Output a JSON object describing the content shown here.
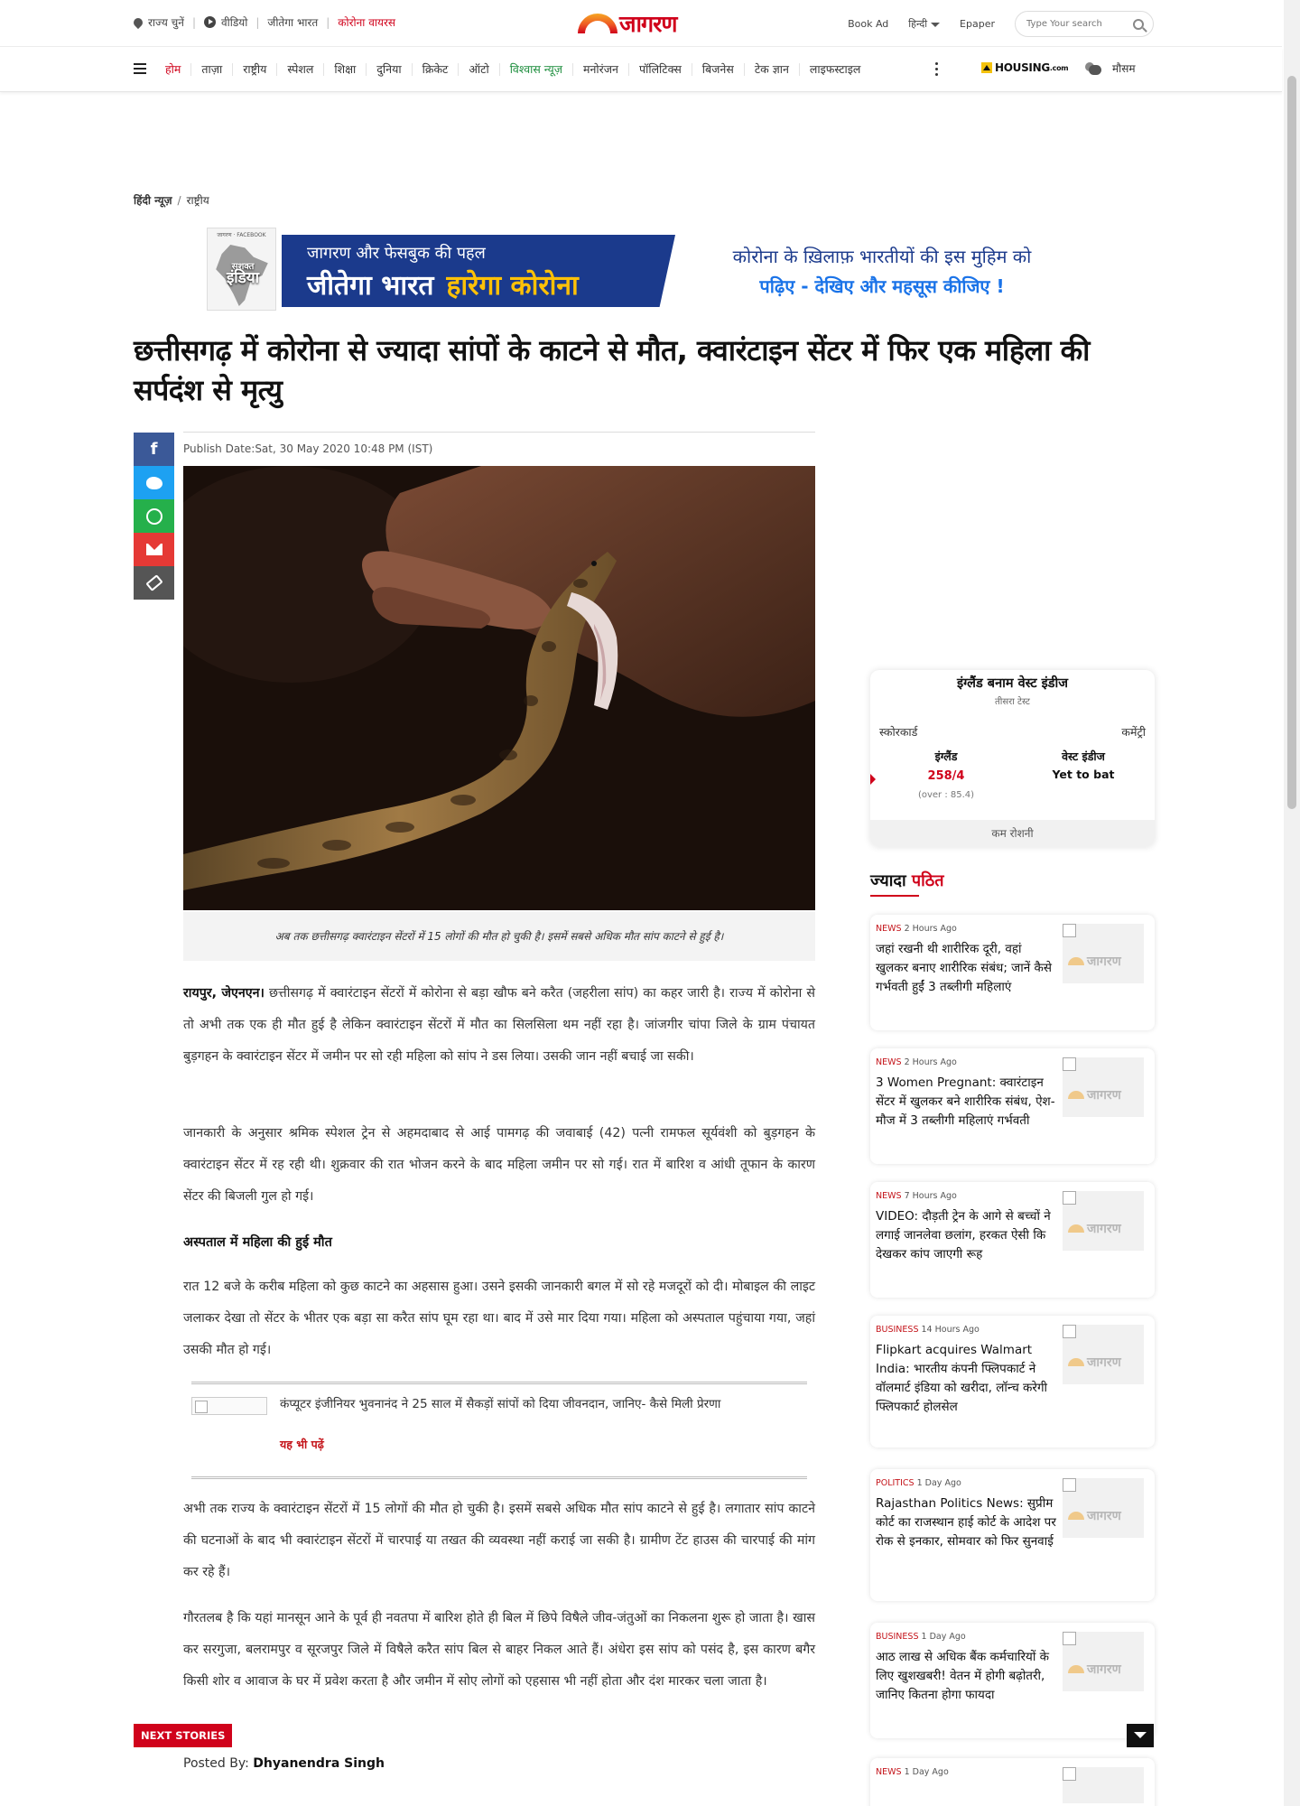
{
  "topbar": {
    "state_select": "राज्य चुनें",
    "video": "वीडियो",
    "jeetega_bharat": "जीतेगा भारत",
    "corona_virus": "कोरोना वायरस",
    "logo_text": "जागरण",
    "book_ad": "Book Ad",
    "language": "हिन्दी",
    "epaper": "Epaper",
    "search_placeholder": "Type Your search"
  },
  "nav": {
    "items": [
      "होम",
      "ताज़ा",
      "राष्ट्रीय",
      "स्पेशल",
      "शिक्षा",
      "दुनिया",
      "क्रिकेट",
      "ऑटो",
      "विश्वास न्यूज़",
      "मनोरंजन",
      "पॉलिटिक्स",
      "बिजनेस",
      "टेक ज्ञान",
      "लाइफस्टाइल"
    ],
    "housing": "HOUSING",
    "housing_suffix": ".com",
    "weather": "मौसम"
  },
  "breadcrumb": {
    "home": "हिंदी न्यूज़",
    "separator": "/",
    "section": "राष्ट्रीय"
  },
  "banner": {
    "badge_top": "जागरण · FACEBOOK",
    "badge_line1": "सशक्त",
    "badge_line2": "इंडिया",
    "line1": "जागरण और फेसबुक की पहल",
    "line2_a": "जीतेगा भारत",
    "line2_b": "हारेगा कोरोना",
    "right1": "कोरोना के ख़िलाफ़ भारतीयों की इस मुहिम को",
    "right2": "पढ़िए - देखिए और महसूस कीजिए !"
  },
  "article": {
    "headline": "छत्तीसगढ़ में कोरोना से ज्यादा सांपों के काटने से मौत, क्वारंटाइन सेंटर में फिर एक महिला की सर्पदंश से मृत्यु",
    "publish_date": "Publish Date:Sat, 30 May 2020 10:48 PM (IST)",
    "caption": "अब तक छत्तीसगढ़ क्वारंटाइन सेंटरों में 15 लोगों की मौत हो चुकी है। इसमें सबसे अधिक मौत सांप काटने से हुई है।",
    "dateline": "रायपुर, जेएनएन।",
    "p1": " छत्तीसगढ़ में क्वारंटाइन सेंटरों में कोरोना से बड़ा खौफ बने करैत (जहरीला सांप) का कहर जारी है। राज्य में कोरोना से तो अभी तक एक ही मौत हुई है लेकिन क्वारंटाइन सेंटरों में मौत का सिलसिला थम नहीं रहा है। जांजगीर चांपा जिले के ग्राम पंचायत बुड़गहन के क्वारंटाइन सेंटर में जमीन पर सो रही महिला को सांप ने डस लिया। उसकी जान नहीं बचाई जा सकी।",
    "p2": "जानकारी के अनुसार श्रमिक स्पेशल ट्रेन से अहमदाबाद से आई पामगढ़ की जवाबाई (42) पत्नी रामफल सूर्यवंशी को बुड़गहन के क्वारंटाइन सेंटर में रह रही थी। शुक्रवार की रात भोजन करने के बाद महिला जमीन पर सो गई। रात में बारिश व आंधी तूफान के कारण सेंटर की बिजली गुल हो गई।",
    "subheading": "अस्पताल में महिला की हुई मौत",
    "p3": "रात 12 बजे के करीब महिला को कुछ काटने का अहसास हुआ। उसने इसकी जानकारी बगल में सो रहे मजदूरों को दी। मोबाइल की लाइट जलाकर देखा तो सेंटर के भीतर एक बड़ा सा करैत सांप घूम रहा था। बाद में उसे मार दिया गया। महिला को अस्पताल पहुंचाया गया, जहां उसकी मौत हो गई।",
    "related_title": "कंप्यूटर इंजीनियर भुवनानंद ने 25 साल में सैकड़ों सांपों को दिया जीवनदान, जानिए- कैसे मिली प्रेरणा",
    "related_label": "यह भी पढ़ें",
    "p4": "अभी तक राज्य के क्वारंटाइन सेंटरों में 15 लोगों की मौत हो चुकी है। इसमें सबसे अधिक मौत सांप काटने से हुई है। लगातार सांप काटने की घटनाओं के बाद भी क्वारंटाइन सेंटरों में चारपाई या तखत की व्यवस्था नहीं कराई जा सकी है। ग्रामीण टेंट हाउस की चारपाई की मांग कर रहे हैं।",
    "p5": "गौरतलब है कि यहां मानसून आने के पूर्व ही नवतपा में बारिश होते ही बिल में छिपे विषैले जीव-जंतुओं का निकलना शुरू हो जाता है। खास कर सरगुजा, बलरामपुर व सूरजपुर जिले में विषैले करैत सांप बिल से बाहर निकल आते हैं। अंधेरा इस सांप को पसंद है, इस कारण बगैर किसी शोर व आवाज के घर में प्रवेश करता है और जमीन में सोए लोगों को एहसास भी नहीं होता और दंश मारकर चला जाता है।",
    "next_stories": "NEXT STORIES",
    "posted_by_label": "Posted By:",
    "posted_by": "Dhyanendra Singh"
  },
  "scorecard": {
    "title": "इंग्लैंड बनाम वेस्ट इंडीज",
    "subtitle": "तीसरा टेस्ट",
    "scorecard_label": "स्कोरकार्ड",
    "commentary_label": "कमेंट्री",
    "team1": "इंग्लैंड",
    "team1_score": "258/4",
    "team1_overs": "(over : 85.4)",
    "team2": "वेस्ट इंडीज",
    "team2_status": "Yet to bat",
    "footer": "कम रोशनी"
  },
  "most_read": {
    "heading_a": "ज्यादा",
    "heading_b": "पठित",
    "logo_text": "जागरण",
    "items": [
      {
        "category": "NEWS",
        "time": "2 Hours Ago",
        "title": "जहां रखनी थी शारीरिक दूरी, वहां खुलकर बनाए शारीरिक संबंध; जानें कैसे गर्भवती हुईं 3 तब्लीगी महिलाएं"
      },
      {
        "category": "NEWS",
        "time": "2 Hours Ago",
        "title": "3 Women Pregnant: क्वारंटाइन सेंटर में खुलकर बने शारीरिक संबंध, ऐश-मौज में 3 तब्लीगी महिलाएं गर्भवती"
      },
      {
        "category": "NEWS",
        "time": "7 Hours Ago",
        "title": "VIDEO: दौड़ती ट्रेन के आगे से बच्चों ने लगाई जानलेवा छलांग, हरकत ऐसी कि देखकर कांप जाएगी रूह"
      },
      {
        "category": "BUSINESS",
        "time": "14 Hours Ago",
        "title": "Flipkart acquires Walmart India: भारतीय कंपनी फ्लिपकार्ट ने वॉलमार्ट इंडिया को खरीदा, लॉन्च करेगी फ्लिपकार्ट होलसेल"
      },
      {
        "category": "POLITICS",
        "time": "1 Day Ago",
        "title": "Rajasthan Politics News: सुप्रीम कोर्ट का राजस्थान हाई कोर्ट के आदेश पर रोक से इनकार, सोमवार को फिर सुनवाई"
      },
      {
        "category": "BUSINESS",
        "time": "1 Day Ago",
        "title": "आठ लाख से अधिक बैंक कर्मचारियों के लिए खुशखबरी! वेतन में होगी बढ़ोतरी, जानिए कितना होगा फायदा"
      },
      {
        "category": "NEWS",
        "time": "1 Day Ago",
        "title": ""
      }
    ]
  },
  "colors": {
    "brand_red": "#d0021b",
    "facebook": "#3b5998",
    "twitter": "#1da1f2",
    "whatsapp": "#25b04b",
    "email": "#e53935"
  }
}
